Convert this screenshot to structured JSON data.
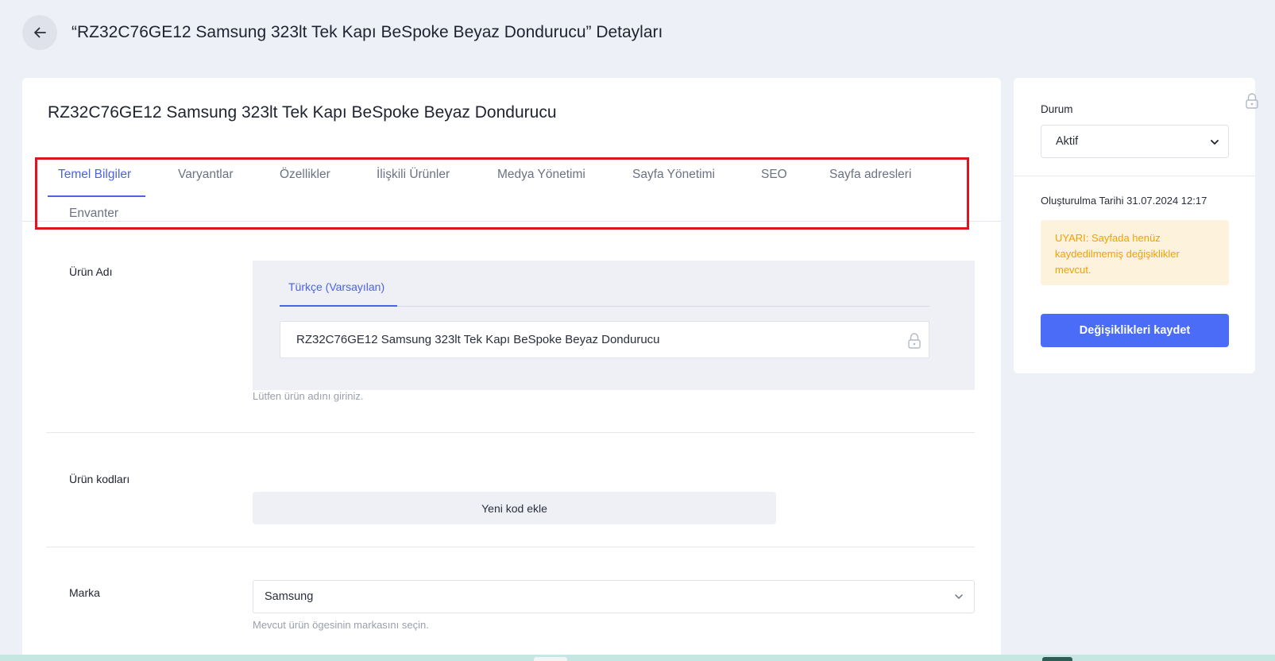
{
  "header": {
    "back_icon": "arrow-left-icon",
    "title": "“RZ32C76GE12 Samsung 323lt Tek Kapı BeSpoke Beyaz Dondurucu” Detayları"
  },
  "main": {
    "product_title": "RZ32C76GE12 Samsung 323lt Tek Kapı BeSpoke Beyaz Dondurucu",
    "tabs": [
      {
        "label": "Temel Bilgiler",
        "active": true
      },
      {
        "label": "Varyantlar"
      },
      {
        "label": "Özellikler"
      },
      {
        "label": "İlişkili Ürünler"
      },
      {
        "label": "Medya Yönetimi"
      },
      {
        "label": "Sayfa Yönetimi"
      },
      {
        "label": "SEO"
      },
      {
        "label": "Sayfa adresleri"
      },
      {
        "label": "Envanter"
      }
    ],
    "product_name": {
      "label": "Ürün Adı",
      "language_tab": "Türkçe (Varsayılan)",
      "value": "RZ32C76GE12 Samsung 323lt Tek Kapı BeSpoke Beyaz Dondurucu",
      "help": "Lütfen ürün adını giriniz."
    },
    "product_codes": {
      "label": "Ürün kodları",
      "add_button": "Yeni kod ekle"
    },
    "brand": {
      "label": "Marka",
      "value": "Samsung",
      "help": "Mevcut ürün ögesinin markasını seçin."
    }
  },
  "sidebar": {
    "status_label": "Durum",
    "status_value": "Aktif",
    "created": "Oluşturulma Tarihi 31.07.2024 12:17",
    "warning": "UYARI: Sayfada henüz kaydedilmemiş değişiklikler mevcut.",
    "save_button": "Değişiklikleri kaydet"
  },
  "colors": {
    "accent": "#4b63e6",
    "primary_button": "#4a6cf7",
    "warning_text": "#f0a300",
    "warning_bg": "#fdf2dc",
    "highlight_border": "#e0141e",
    "page_bg": "#edf0f7"
  }
}
